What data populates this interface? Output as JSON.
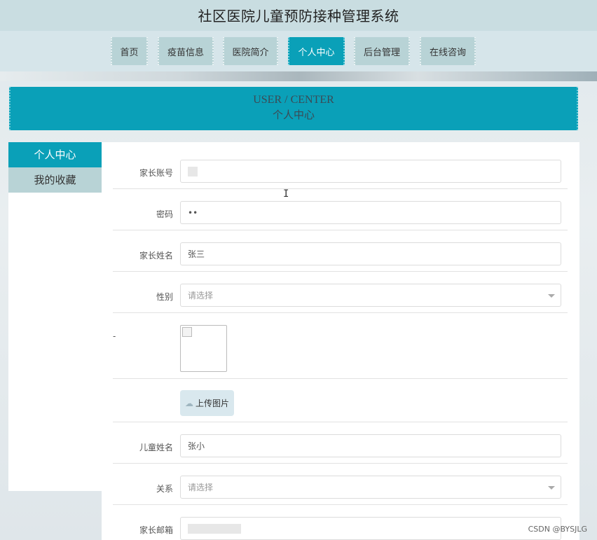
{
  "header": {
    "title": "社区医院儿童预防接种管理系统"
  },
  "nav": {
    "items": [
      {
        "label": "首页"
      },
      {
        "label": "疫苗信息"
      },
      {
        "label": "医院简介"
      },
      {
        "label": "个人中心"
      },
      {
        "label": "后台管理"
      },
      {
        "label": "在线咨询"
      }
    ],
    "active": "个人中心"
  },
  "band": {
    "title_en": "USER / CENTER",
    "title_cn": "个人中心"
  },
  "side_menu": {
    "items": [
      {
        "label": "个人中心"
      },
      {
        "label": "我的收藏"
      }
    ],
    "active": "个人中心"
  },
  "form": {
    "account": {
      "label": "家长账号",
      "value": ""
    },
    "password": {
      "label": "密码",
      "value": "••"
    },
    "parent_name": {
      "label": "家长姓名",
      "value": "张三"
    },
    "gender": {
      "label": "性别",
      "placeholder": "请选择"
    },
    "photo": {
      "label": "-"
    },
    "upload": {
      "label": "上传图片"
    },
    "child_name": {
      "label": "儿童姓名",
      "value": "张小"
    },
    "relation": {
      "label": "关系",
      "placeholder": "请选择"
    },
    "email": {
      "label": "家长邮箱",
      "value": ""
    }
  },
  "icons": {
    "cloud": "cloud-upload-icon",
    "caret": "chevron-down-icon",
    "cursor": "text-cursor-icon"
  },
  "colors": {
    "accent": "#0aa0b8",
    "nav_bg": "#b8d3d6",
    "header_bg": "#c9dde1"
  },
  "watermark": "CSDN @BYSJLG"
}
